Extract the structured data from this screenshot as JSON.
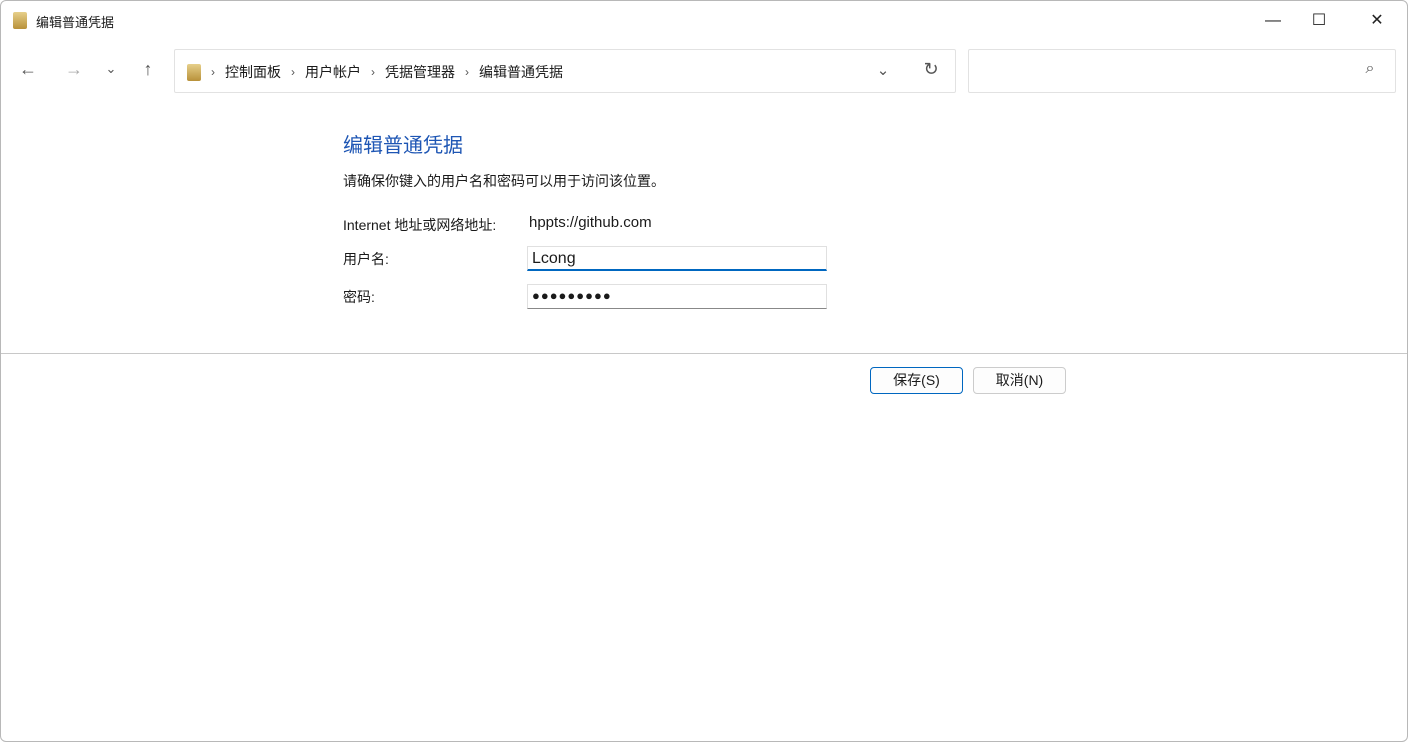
{
  "window": {
    "title": "编辑普通凭据",
    "minimize": "—",
    "maximize": "☐",
    "close": "✕"
  },
  "nav": {
    "back": "←",
    "forward": "→",
    "recent": "⌄",
    "up": "↑",
    "dropdown": "⌄",
    "refresh": "↻",
    "search_icon": "⌕"
  },
  "breadcrumb": [
    "控制面板",
    "用户帐户",
    "凭据管理器",
    "编辑普通凭据"
  ],
  "main": {
    "heading": "编辑普通凭据",
    "description": "请确保你键入的用户名和密码可以用于访问该位置。",
    "address_label": "Internet 地址或网络地址:",
    "address_value": "hppts://github.com",
    "username_label": "用户名:",
    "username_value": "Lcong",
    "password_label": "密码:",
    "password_value": "●●●●●●●●●"
  },
  "buttons": {
    "save": "保存(S)",
    "cancel": "取消(N)"
  }
}
